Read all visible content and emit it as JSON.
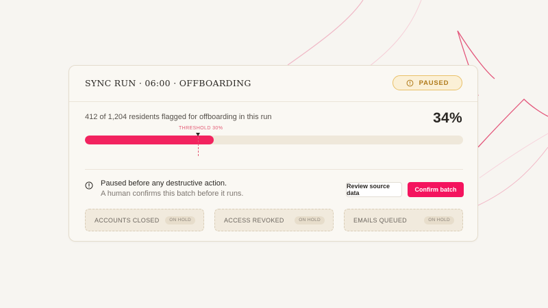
{
  "run": {
    "title": "SYNC RUN · 06:00 · OFFBOARDING",
    "status": "PAUSED",
    "status_icon": "clock-icon"
  },
  "progress": {
    "summary": "412 of 1,204 residents flagged for offboarding in this run",
    "percent_label": "34%",
    "fraction": 0.34,
    "threshold_label": "THRESHOLD 30%",
    "threshold_fraction": 0.3
  },
  "notice": {
    "icon": "info-icon",
    "title": "Paused before any destructive action.",
    "subtitle": "A human confirms this batch before it runs."
  },
  "actions": {
    "review_label": "Review source data",
    "confirm_label": "Confirm batch"
  },
  "stages": [
    {
      "label": "ACCOUNTS CLOSED",
      "tag": "ON HOLD"
    },
    {
      "label": "ACCESS REVOKED",
      "tag": "ON HOLD"
    },
    {
      "label": "EMAILS QUEUED",
      "tag": "ON HOLD"
    }
  ],
  "colors": {
    "accent": "#f4145e",
    "paused_border": "#e9c068",
    "paused_text": "#b07a1a",
    "threshold": "#e35a74"
  }
}
